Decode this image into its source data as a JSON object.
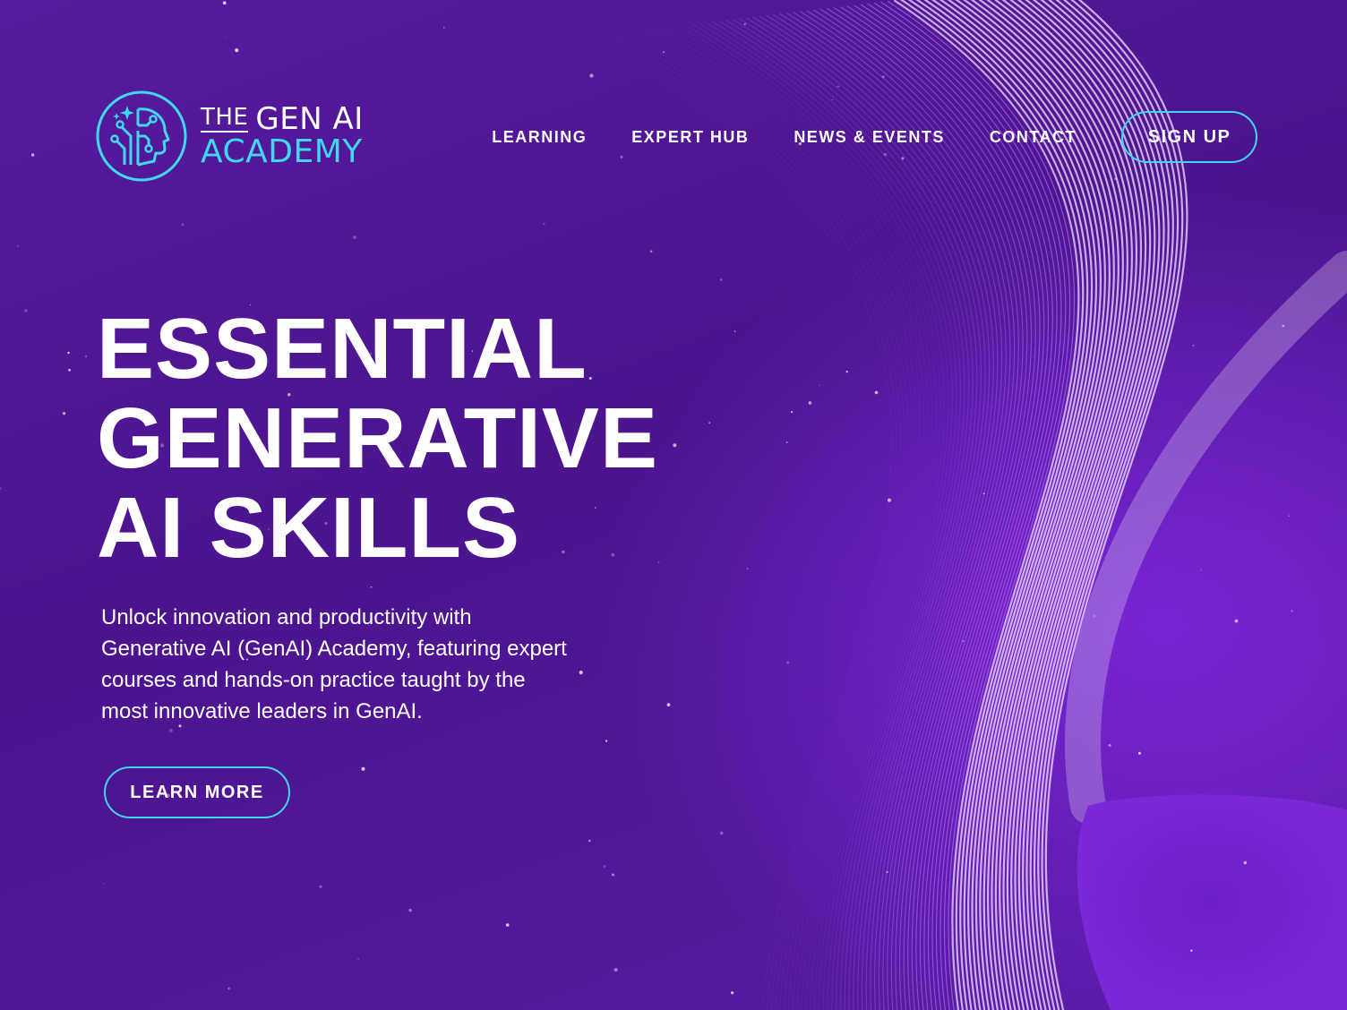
{
  "brand": {
    "name_the": "THE",
    "name_gen_ai": "GEN AI",
    "name_academy": "ACADEMY",
    "logo_icon": "ai-head-circuit-icon",
    "accent_color": "#3fd8ee"
  },
  "nav": {
    "items": [
      {
        "label": "LEARNING"
      },
      {
        "label": "EXPERT HUB"
      },
      {
        "label": "NEWS & EVENTS"
      },
      {
        "label": "CONTACT"
      }
    ],
    "signup_label": "SIGN UP"
  },
  "hero": {
    "title_lines": [
      "ESSENTIAL",
      "GENERATIVE",
      "AI SKILLS"
    ],
    "body": "Unlock innovation and productivity with Generative AI (GenAI) Academy, featuring expert courses and hands-on practice taught by the most innovative leaders in GenAI.",
    "cta_label": "LEARN MORE"
  },
  "colors": {
    "background": "#4f1592",
    "streak_light": "#e6c8ff",
    "streak_mid": "#a64cf0"
  }
}
